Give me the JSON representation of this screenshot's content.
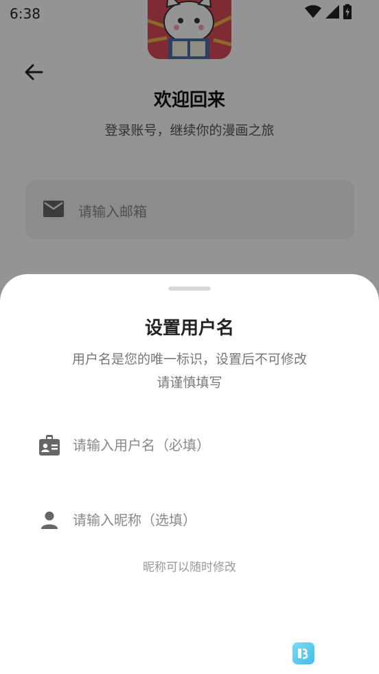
{
  "status_bar": {
    "time": "6:38"
  },
  "login_page": {
    "title": "欢迎回来",
    "subtitle": "登录账号，继续你的漫画之旅",
    "email_placeholder": "请输入邮箱"
  },
  "sheet": {
    "title": "设置用户名",
    "description_line1": "用户名是您的唯一标识，设置后不可修改",
    "description_line2": "请谨慎填写",
    "username_field": {
      "value": "",
      "placeholder": "请输入用户名（必填）"
    },
    "nickname_field": {
      "value": "",
      "placeholder": "请输入昵称（选填）"
    },
    "nickname_hint": "昵称可以随时修改"
  },
  "icons": {
    "back": "arrow-left-icon",
    "email": "mail-icon",
    "username": "badge-icon",
    "nickname": "person-icon",
    "wifi": "wifi-icon",
    "signal": "signal-icon",
    "battery": "battery-icon"
  },
  "colors": {
    "sheet_background": "#ffffff",
    "scrim": "rgba(0,0,0,0.42)",
    "logo_background": "#d94b5a",
    "icon_gray": "#666666",
    "hint_gray": "#999999"
  }
}
